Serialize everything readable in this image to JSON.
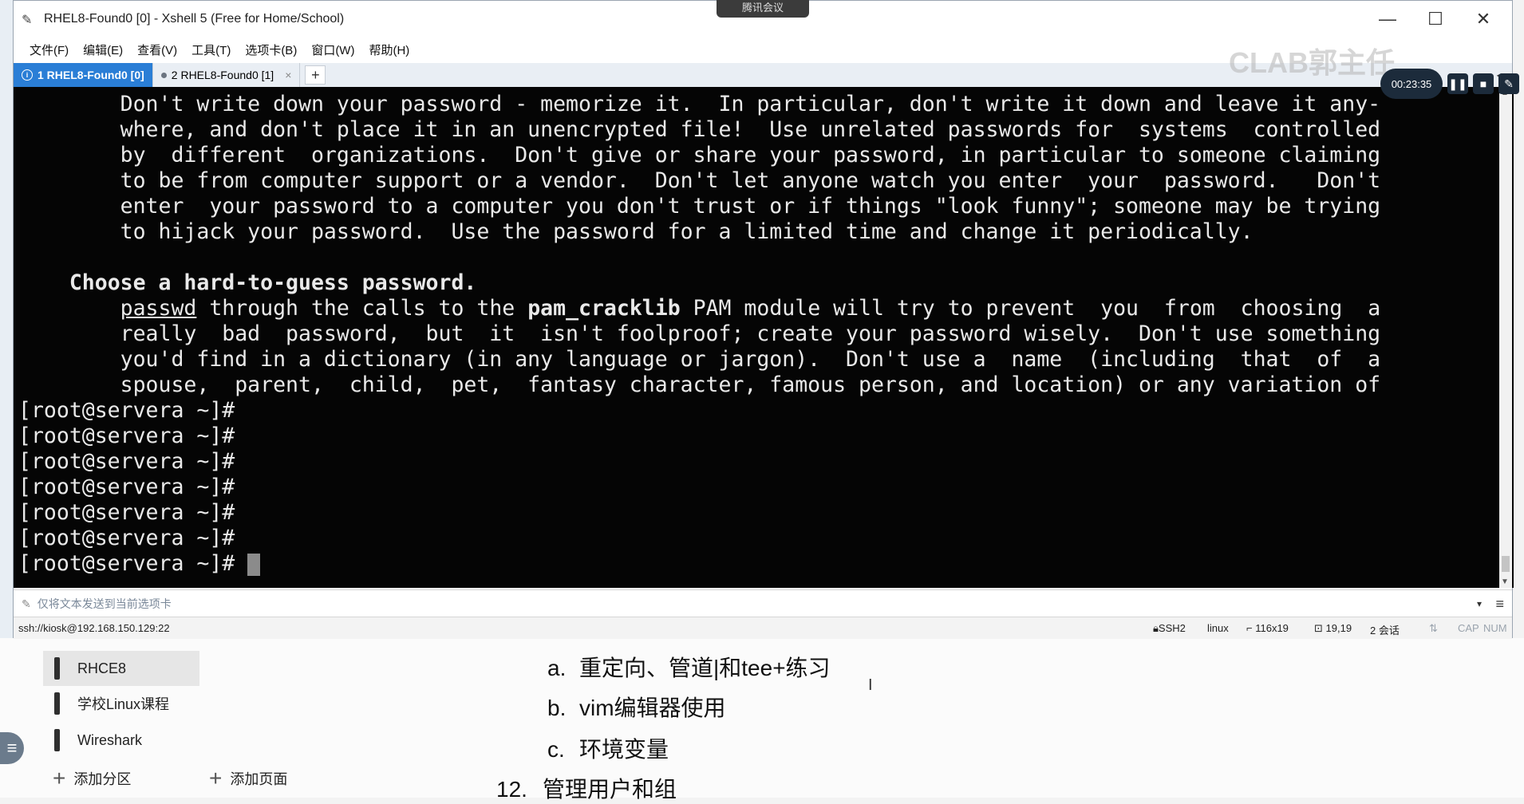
{
  "meeting": {
    "badge": "腾讯会议",
    "watermark": "CLAB郭主任",
    "timer": "00:23:35"
  },
  "window": {
    "title": "RHEL8-Found0 [0] - Xshell 5 (Free for Home/School)",
    "menu": [
      "文件(F)",
      "编辑(E)",
      "查看(V)",
      "工具(T)",
      "选项卡(B)",
      "窗口(W)",
      "帮助(H)"
    ],
    "tabs": [
      {
        "label": "1 RHEL8-Found0 [0]",
        "active": true
      },
      {
        "label": "2 RHEL8-Found0 [1]",
        "active": false
      }
    ]
  },
  "terminal": {
    "lines": [
      "        Don't write down your password - memorize it.  In particular, don't write it down and leave it any-",
      "        where, and don't place it in an unencrypted file!  Use unrelated passwords for  systems  controlled",
      "        by  different  organizations.  Don't give or share your password, in particular to someone claiming",
      "        to be from computer support or a vendor.  Don't let anyone watch you enter  your  password.   Don't",
      "        enter  your password to a computer you don't trust or if things \"look funny\"; someone may be trying",
      "        to hijack your password.  Use the password for a limited time and change it periodically.",
      "",
      "    Choose a hard-to-guess password.",
      "        passwd through the calls to the pam_cracklib PAM module will try to prevent  you  from  choosing  a",
      "        really  bad  password,  but  it  isn't foolproof; create your password wisely.  Don't use something",
      "        you'd find in a dictionary (in any language or jargon).  Don't use a  name  (including  that  of  a",
      "        spouse,  parent,  child,  pet,  fantasy character, famous person, and location) or any variation of",
      "[root@servera ~]#",
      "[root@servera ~]#",
      "[root@servera ~]#",
      "[root@servera ~]#",
      "[root@servera ~]#",
      "[root@servera ~]#",
      "[root@servera ~]# "
    ],
    "heading": "Choose a hard-to-guess password.",
    "cmd_passwd": "passwd",
    "mid_text": " through the calls to the ",
    "module": "pam_cracklib",
    "rest_text": " PAM module will try to prevent  you  from  choosing  a"
  },
  "compose": {
    "placeholder": "仅将文本发送到当前选项卡"
  },
  "status": {
    "connection": "ssh://kiosk@192.168.150.129:22",
    "protocol": "SSH2",
    "os": "linux",
    "size": "116x19",
    "cursor_pos": "19,19",
    "sessions": "2 会话",
    "cap": "CAP",
    "num": "NUM"
  },
  "notes": {
    "sections": [
      {
        "label": "RHCE8",
        "active": true
      },
      {
        "label": "学校Linux课程",
        "active": false
      },
      {
        "label": "Wireshark",
        "active": false
      }
    ],
    "add_section": "添加分区",
    "add_page": "添加页面",
    "outline": [
      {
        "marker": "a.",
        "text": "重定向、管道|和tee+练习"
      },
      {
        "marker": "b.",
        "text": "vim编辑器使用"
      },
      {
        "marker": "c.",
        "text": "环境变量"
      },
      {
        "marker": "12.",
        "text": "管理用户和组"
      }
    ]
  }
}
